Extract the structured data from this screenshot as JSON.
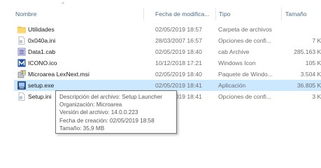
{
  "columns": {
    "name": "Nombre",
    "date": "Fecha de modifica...",
    "type": "Tipo",
    "size": "Tamaño"
  },
  "files": [
    {
      "name": "Utilidades",
      "date": "02/05/2019 18:57",
      "type": "Carpeta de archivos",
      "size": "",
      "icon": "folder-icon"
    },
    {
      "name": "0x040a.ini",
      "date": "28/03/2007 16:57",
      "type": "Opciones de confi...",
      "size": "7 KB",
      "icon": "ini-file-icon"
    },
    {
      "name": "Data1.cab",
      "date": "02/05/2019 18:40",
      "type": "cab Archive",
      "size": "285.163 KB",
      "icon": "cab-archive-icon"
    },
    {
      "name": "ICONO.ico",
      "date": "10/12/2018 17:21",
      "type": "Windows Icon",
      "size": "105 KB",
      "icon": "ico-file-icon"
    },
    {
      "name": "Microarea LexNext.msi",
      "date": "02/05/2019 18:40",
      "type": "Paquete de Windo...",
      "size": "3.504 KB",
      "icon": "msi-package-icon"
    },
    {
      "name": "setup.exe",
      "date": "02/05/2019 18:41",
      "type": "Aplicación",
      "size": "36.805 KB",
      "icon": "exe-app-icon"
    },
    {
      "name": "Setup.ini",
      "date": "02/05/2019 18:41",
      "type": "Opciones de confi...",
      "size": "3 KB",
      "icon": "ini-file-icon"
    }
  ],
  "tooltip": {
    "description": "Descripción del archivo: Setup Launcher",
    "organization": "Organización: Microarea",
    "version": "Versión del archivo: 14.0.0.223",
    "created": "Fecha de creación: 02/05/2019 18:58",
    "size": "Tamaño: 35,9 MB"
  }
}
